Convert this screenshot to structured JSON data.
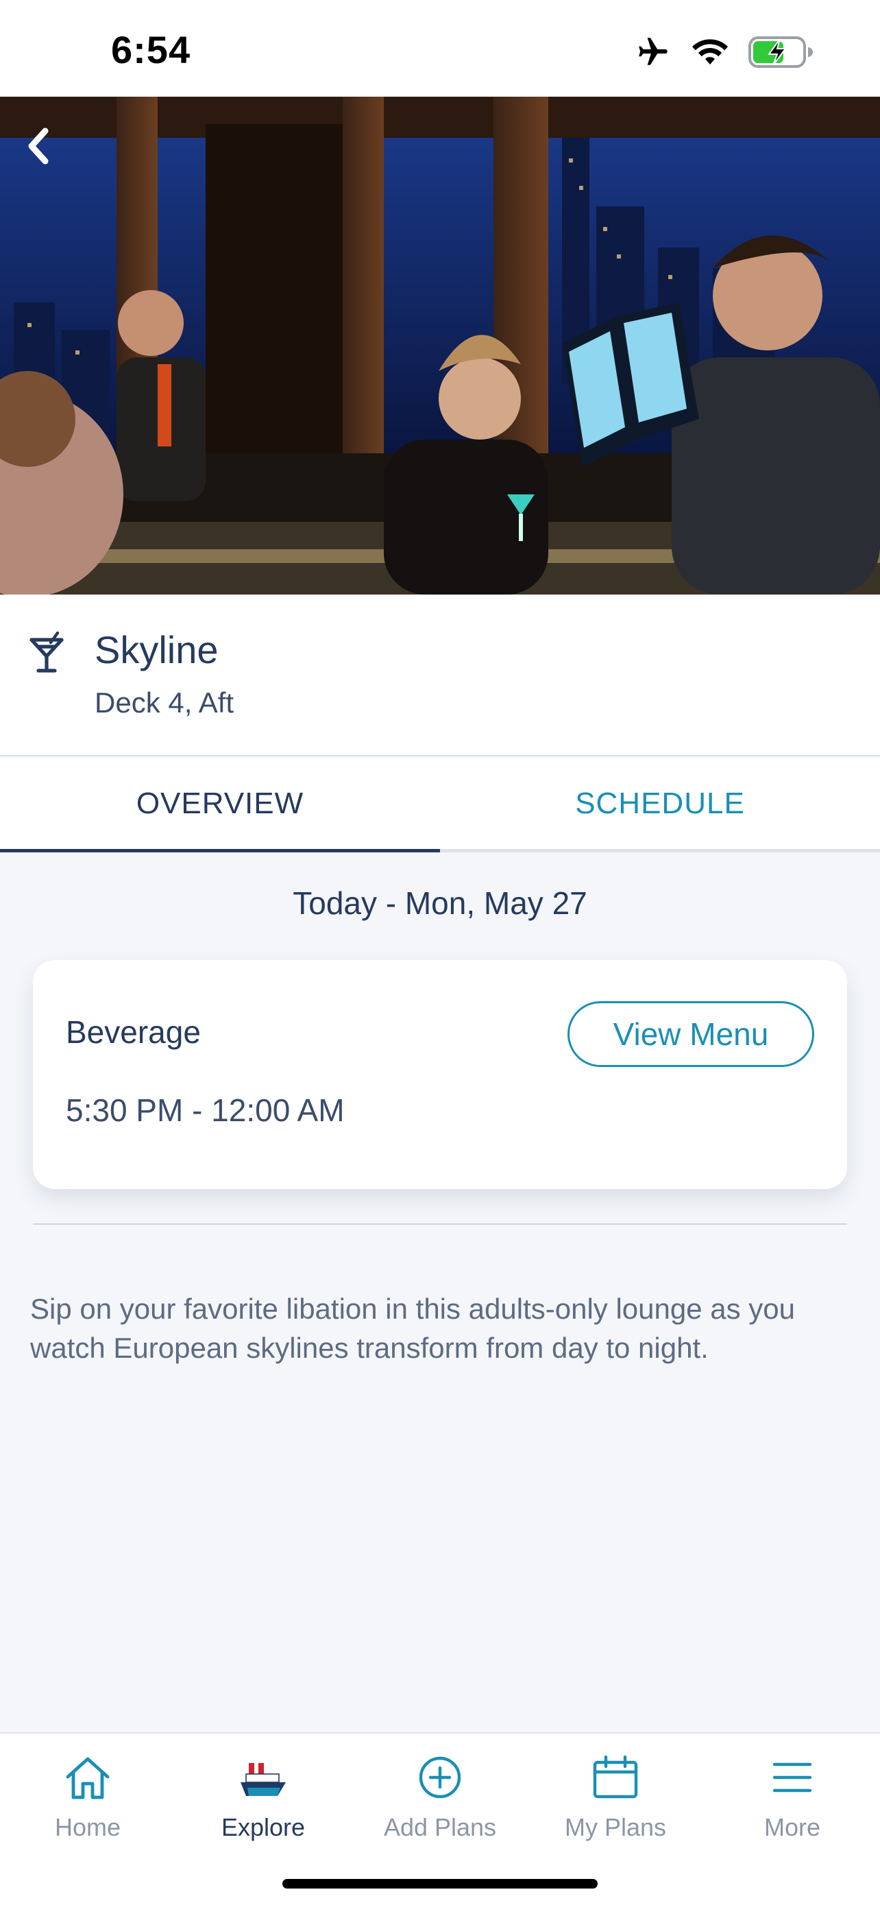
{
  "status_bar": {
    "time": "6:54",
    "icons": [
      "airplane-icon",
      "wifi-icon",
      "battery-charging-icon"
    ],
    "battery_color": "#32c93b"
  },
  "hero": {
    "image": "Lounge bar interior with guests and city skyline at night",
    "back_icon": "chevron-left-icon"
  },
  "venue": {
    "icon": "cocktail-icon",
    "title": "Skyline",
    "location": "Deck 4, Aft"
  },
  "tabs": [
    {
      "label": "OVERVIEW",
      "active": true
    },
    {
      "label": "SCHEDULE",
      "active": false
    }
  ],
  "main": {
    "date_heading": "Today - Mon, May 27",
    "card": {
      "category": "Beverage",
      "button_label": "View Menu",
      "hours": "5:30 PM - 12:00 AM"
    },
    "description": "Sip on your favorite libation in this adults-only lounge as you watch European skylines transform from day to night."
  },
  "bottom_nav": [
    {
      "label": "Home",
      "icon": "home-icon",
      "active": false
    },
    {
      "label": "Explore",
      "icon": "ship-icon",
      "active": true
    },
    {
      "label": "Add Plans",
      "icon": "plus-circle-icon",
      "active": false
    },
    {
      "label": "My Plans",
      "icon": "calendar-icon",
      "active": false
    },
    {
      "label": "More",
      "icon": "menu-icon",
      "active": false
    }
  ],
  "colors": {
    "primary_navy": "#253a5e",
    "accent_teal": "#1a8fb5",
    "background": "#f4f6fa"
  }
}
